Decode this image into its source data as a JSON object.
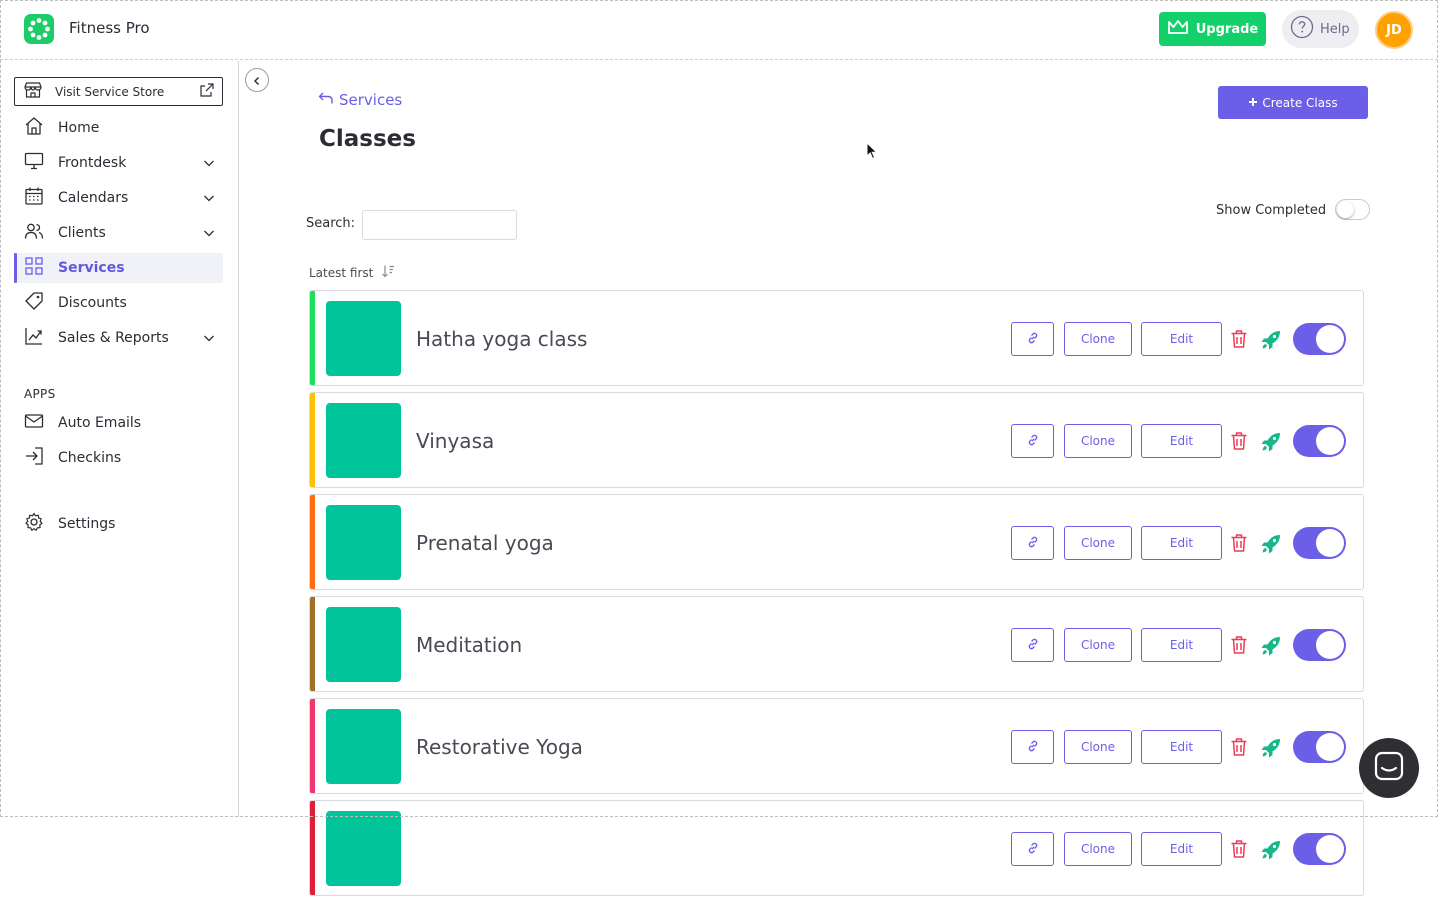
{
  "app": {
    "title": "Fitness Pro"
  },
  "header": {
    "upgrade_label": "Upgrade",
    "help_label": "Help",
    "avatar_initials": "JD"
  },
  "sidebar": {
    "store_button": "Visit Service Store",
    "items": [
      {
        "label": "Home",
        "icon": "home-icon",
        "expandable": false,
        "active": false
      },
      {
        "label": "Frontdesk",
        "icon": "monitor-icon",
        "expandable": true,
        "active": false
      },
      {
        "label": "Calendars",
        "icon": "calendar-icon",
        "expandable": true,
        "active": false
      },
      {
        "label": "Clients",
        "icon": "users-icon",
        "expandable": true,
        "active": false
      },
      {
        "label": "Services",
        "icon": "grid-icon",
        "expandable": false,
        "active": true
      },
      {
        "label": "Discounts",
        "icon": "tag-icon",
        "expandable": false,
        "active": false
      },
      {
        "label": "Sales & Reports",
        "icon": "chart-icon",
        "expandable": true,
        "active": false
      }
    ],
    "apps_section_label": "APPS",
    "apps": [
      {
        "label": "Auto Emails",
        "icon": "mail-icon"
      },
      {
        "label": "Checkins",
        "icon": "login-icon"
      }
    ],
    "settings_label": "Settings"
  },
  "main": {
    "back_link": "Services",
    "title": "Classes",
    "create_button": "Create Class",
    "show_completed_label": "Show Completed",
    "show_completed_on": false,
    "search_label": "Search:",
    "search_value": "",
    "sort_label": "Latest first",
    "button_labels": {
      "clone": "Clone",
      "edit": "Edit"
    },
    "classes": [
      {
        "name": "Hatha yoga class",
        "accent": "#1fe05a",
        "enabled": true
      },
      {
        "name": "Vinyasa",
        "accent": "#ffc107",
        "enabled": true
      },
      {
        "name": "Prenatal yoga",
        "accent": "#ff6d12",
        "enabled": true
      },
      {
        "name": "Meditation",
        "accent": "#a0702a",
        "enabled": true
      },
      {
        "name": "Restorative Yoga",
        "accent": "#f2366f",
        "enabled": true
      },
      {
        "name": "",
        "accent": "#e01e3a",
        "enabled": true
      }
    ]
  },
  "colors": {
    "brand_green": "#14d06b",
    "accent_purple": "#6a5fe6",
    "thumbnail": "#00c49a",
    "avatar": "#ffa100"
  }
}
